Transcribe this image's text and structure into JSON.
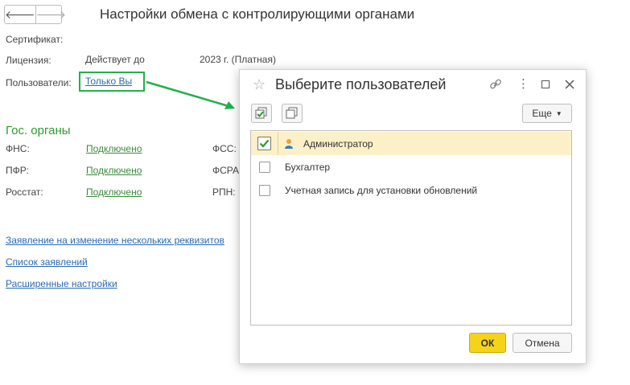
{
  "nav": {
    "back": "🡐",
    "forward": "🡒"
  },
  "page": {
    "title": "Настройки обмена с контролирующими органами"
  },
  "fields": {
    "certificate_label": "Сертификат:",
    "license_label": "Лицензия:",
    "license_value_prefix": "Действует до",
    "license_value_suffix": "2023 г. (Платная)",
    "users_label": "Пользователи:",
    "users_link": "Только Вы"
  },
  "gov": {
    "section_title": "Гос. органы",
    "left": [
      {
        "label": "ФНС:",
        "status": "Подключено"
      },
      {
        "label": "ПФР:",
        "status": "Подключено"
      },
      {
        "label": "Росстат:",
        "status": "Подключено"
      }
    ],
    "right": [
      {
        "label": "ФСС:"
      },
      {
        "label": "ФСРА"
      },
      {
        "label": "РПН:"
      }
    ]
  },
  "links": {
    "change_requisites": "Заявление на изменение нескольких реквизитов",
    "requests_list": "Список заявлений",
    "advanced": "Расширенные настройки"
  },
  "dialog": {
    "title": "Выберите пользователей",
    "more_label": "Еще",
    "users": [
      {
        "name": "Администратор",
        "checked": true,
        "selected": true
      },
      {
        "name": "Бухгалтер",
        "checked": false,
        "selected": false
      },
      {
        "name": "Учетная запись для установки обновлений",
        "checked": false,
        "selected": false
      }
    ],
    "ok_label": "ОК",
    "cancel_label": "Отмена"
  },
  "colors": {
    "highlight": "#22b04b",
    "ok_button": "#f5d31a",
    "selected_row": "#fbf0c7",
    "section": "#2e9a2e",
    "link": "#2a6ab3"
  }
}
